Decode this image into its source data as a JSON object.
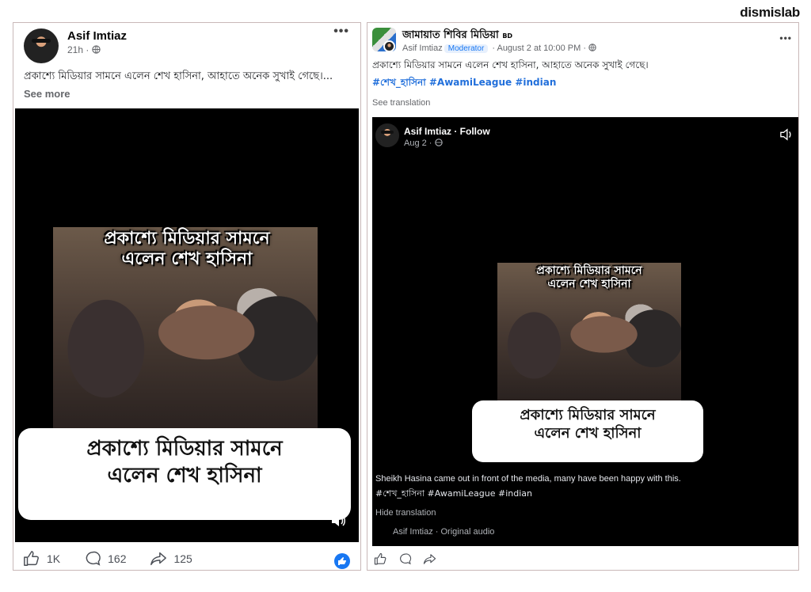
{
  "brand": "dismislab",
  "left_post": {
    "author": "Asif Imtiaz",
    "time": "21h · ",
    "caption": "প্রকাশ্যে মিডিয়ার সামনে এলেন শেখ হাসিনা, আহাতে অনেক সুখাই গেছে।...",
    "see_more": " See more",
    "video_title_line1": "প্রকাশ্যে মিডিয়ার সামনে",
    "video_title_line2": "এলেন শেখ হাসিনা",
    "video_caption_line1": "প্রকাশ্যে মিডিয়ার সামনে",
    "video_caption_line2": "এলেন শেখ হাসিনা",
    "likes": "1K",
    "comments": "162",
    "shares": "125"
  },
  "right_post": {
    "group_name": "জামায়াত শিবির মিডিয়া",
    "group_suffix": "BD",
    "author": "Asif Imtiaz",
    "role": "Moderator",
    "time": " · August 2 at 10:00 PM · ",
    "caption": "প্রকাশ্যে মিডিয়ার সামনে এলেন শেখ হাসিনা, আহাতে অনেক সুখাই গেছে।",
    "hashtags": "#শেখ_হাসিনা #AwamiLeague #indian",
    "see_translation": "See translation",
    "inner_author": "Asif Imtiaz · Follow",
    "inner_time": "Aug 2 · ",
    "video_title_line1": "প্রকাশ্যে মিডিয়ার সামনে",
    "video_title_line2": "এলেন শেখ হাসিনা",
    "video_caption_line1": "প্রকাশ্যে মিডিয়ার সামনে",
    "video_caption_line2": "এলেন শেখ হাসিনা",
    "translation": "Sheikh Hasina came out in front of the media, many have been happy with this.",
    "translation_tags": "#শেখ_হাসিনা #AwamiLeague #indian",
    "hide_translation": "Hide translation",
    "audio": "Asif Imtiaz · Original audio"
  },
  "colors": {
    "accent": "#1877f2",
    "panel_border": "#c9b8b8"
  },
  "icons": [
    "more-icon",
    "globe-icon",
    "sound-icon",
    "like-icon",
    "comment-icon",
    "share-icon",
    "like-badge-icon"
  ]
}
